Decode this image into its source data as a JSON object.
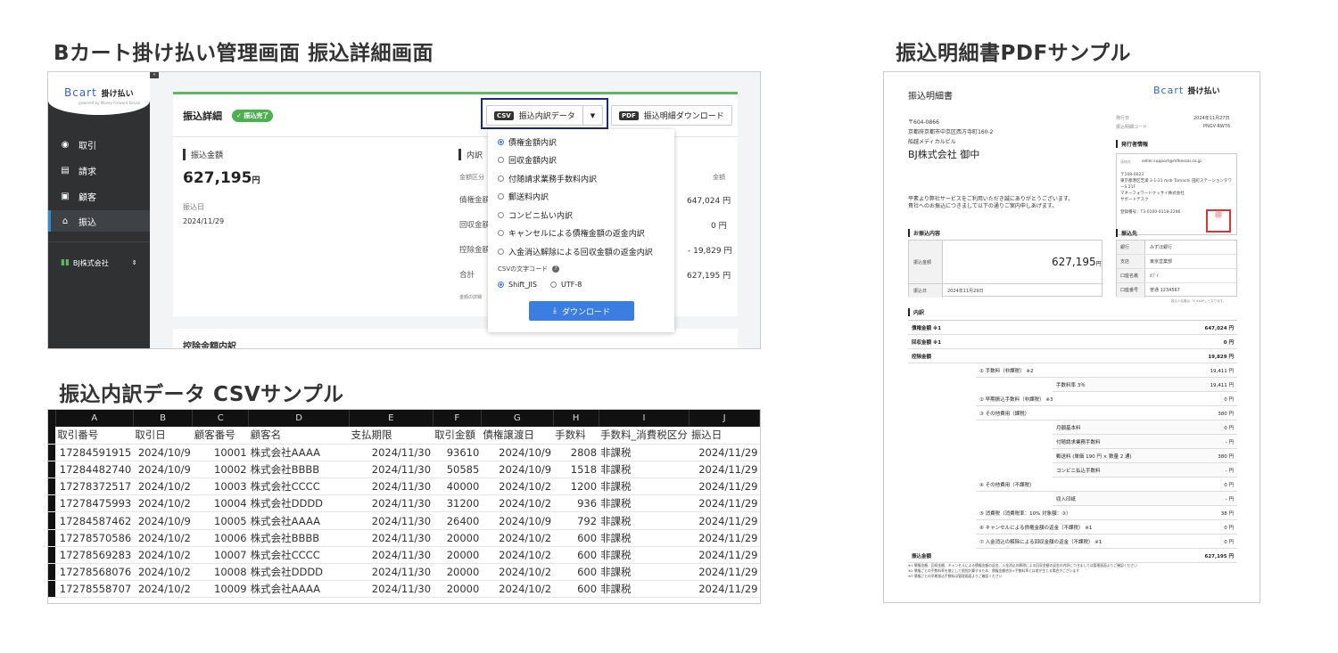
{
  "titles": {
    "admin": "Bカート掛け払い管理画面 振込詳細画面",
    "csv": "振込内訳データ CSVサンプル",
    "pdf": "振込明細書PDFサンプル"
  },
  "admin": {
    "logo": {
      "brand": "Bcart",
      "suffix": "掛け払い",
      "sub": "powered by Money Forward Kessai"
    },
    "nav": [
      {
        "label": "取引",
        "icon": "eye-icon"
      },
      {
        "label": "請求",
        "icon": "document-icon"
      },
      {
        "label": "顧客",
        "icon": "user-card-icon"
      },
      {
        "label": "振込",
        "icon": "bank-icon"
      }
    ],
    "company": "BJ株式会社",
    "header": {
      "title": "振込詳細",
      "badge": "✓ 振込完了",
      "csv_tag": "CSV",
      "csv_label": "振込内訳データ",
      "pdf_tag": "PDF",
      "pdf_label": "振込明細ダウンロード"
    },
    "amount": {
      "label": "振込金額",
      "value": "627,195",
      "unit": "円",
      "date_label": "振込日",
      "date": "2024/11/29"
    },
    "breakdown": {
      "label": "内訳",
      "col1": "金額区分",
      "col2": "金額",
      "rows": [
        {
          "label": "債権金額",
          "value": "647,024 円"
        },
        {
          "label": "回収金額",
          "value": "0 円"
        },
        {
          "label": "控除金額",
          "value": "- 19,829 円"
        },
        {
          "label": "合計",
          "value": "627,195 円"
        }
      ],
      "note": "金額の詳細"
    },
    "dropdown": {
      "options": [
        "債権金額内訳",
        "回収金額内訳",
        "付随請求業務手数料内訳",
        "郵送料内訳",
        "コンビニ払い内訳",
        "キャンセルによる債権金額の返金内訳",
        "入金消込解除による回収金額の返金内訳"
      ],
      "encoding_label": "CSVの文字コード",
      "enc1": "Shift_JIS",
      "enc2": "UTF-8",
      "download": "ダウンロード"
    },
    "next_section": "控除金額内訳"
  },
  "sheet": {
    "cols": [
      "A",
      "B",
      "C",
      "D",
      "E",
      "F",
      "G",
      "H",
      "I",
      "J"
    ],
    "headers": [
      "取引番号",
      "取引日",
      "顧客番号",
      "顧客名",
      "支払期限",
      "取引金額",
      "債権譲渡日",
      "手数料",
      "手数料_消費税区分",
      "振込日"
    ],
    "rows": [
      [
        "17284591915",
        "2024/10/9",
        "10001",
        "株式会社AAAA",
        "2024/11/30",
        "93610",
        "2024/10/9",
        "2808",
        "非課税",
        "2024/11/29"
      ],
      [
        "17284482740",
        "2024/10/9",
        "10002",
        "株式会社BBBB",
        "2024/11/30",
        "50585",
        "2024/10/9",
        "1518",
        "非課税",
        "2024/11/29"
      ],
      [
        "17278372517",
        "2024/10/2",
        "10003",
        "株式会社CCCC",
        "2024/11/30",
        "40000",
        "2024/10/2",
        "1200",
        "非課税",
        "2024/11/29"
      ],
      [
        "17278475993",
        "2024/10/2",
        "10004",
        "株式会社DDDD",
        "2024/11/30",
        "31200",
        "2024/10/2",
        "936",
        "非課税",
        "2024/11/29"
      ],
      [
        "17284587462",
        "2024/10/9",
        "10005",
        "株式会社AAAA",
        "2024/11/30",
        "26400",
        "2024/10/9",
        "792",
        "非課税",
        "2024/11/29"
      ],
      [
        "17278570586",
        "2024/10/2",
        "10006",
        "株式会社BBBB",
        "2024/11/30",
        "20000",
        "2024/10/2",
        "600",
        "非課税",
        "2024/11/29"
      ],
      [
        "17278569283",
        "2024/10/2",
        "10007",
        "株式会社CCCC",
        "2024/11/30",
        "20000",
        "2024/10/2",
        "600",
        "非課税",
        "2024/11/29"
      ],
      [
        "17278568076",
        "2024/10/2",
        "10008",
        "株式会社DDDD",
        "2024/11/30",
        "20000",
        "2024/10/2",
        "600",
        "非課税",
        "2024/11/29"
      ],
      [
        "17278558707",
        "2024/10/2",
        "10009",
        "株式会社AAAA",
        "2024/11/30",
        "20000",
        "2024/10/2",
        "600",
        "非課税",
        "2024/11/29"
      ]
    ]
  },
  "pdf": {
    "title": "振込明細書",
    "logo": "Bcart",
    "logo_suffix": "掛け払い",
    "postal": "〒604-0866",
    "addr": "京都府京都市中京区西方寺町160-2",
    "bldg": "船越メディカルビル",
    "recipient": "BJ株式会社 御中",
    "greeting1": "平素より弊社サービスをご利用いただき誠にありがとうございます。",
    "greeting2": "貴社へのお振込につきまして以下の通りご案内申しあげます。",
    "issue_label": "発行日",
    "issue_date": "2024年11月27日",
    "code_label": "振込明細コード",
    "code": "PNGV-RW76",
    "issuer_label": "発行者情報",
    "contact_label": "連絡先",
    "email": "seller.support@mfkessai.co.jp",
    "issuer_lines": [
      "〒108-0023",
      "東京都港区芝浦 3-1-21 msb Tamachi 田町ステーションタワーS 21F",
      "マネーフォワードケッサイ株式会社",
      "サポートデスク"
    ],
    "reg": "登録番号：T3-0100-0118-2296",
    "transfer_label": "お振込内容",
    "amount_label": "振込金額",
    "amount": "627,195",
    "unit": "円",
    "date_label": "振込日",
    "date": "2024年11月29日",
    "dest_label": "振込先",
    "dest": [
      [
        "銀行",
        "みずほ銀行"
      ],
      [
        "支店",
        "東京営業部"
      ],
      [
        "口座名義",
        "ｶﾌﾞｲ"
      ],
      [
        "口座番号",
        "普通 1234567"
      ]
    ],
    "dest_note": "振込人名義は「X XXXP」となります。",
    "items_label": "内訳",
    "items": [
      {
        "label": "債権金額 ※1",
        "value": "647,024 円",
        "bold": true
      },
      {
        "label": "回収金額 ※1",
        "value": "0 円",
        "bold": true
      },
      {
        "label": "控除金額",
        "value": "19,829 円",
        "bold": true
      },
      {
        "label": "① 手数料（非課税） ※2",
        "value": "19,411 円",
        "indent": 1
      },
      {
        "label": "手数料率 3％",
        "value": "19,411 円",
        "indent": 2
      },
      {
        "label": "② 早期振込手数料（非課税） ※3",
        "value": "0 円",
        "indent": 1
      },
      {
        "label": "③ その他費用（課税）",
        "value": "380 円",
        "indent": 1
      },
      {
        "label": "月額基本料",
        "value": "0 円",
        "indent": 2
      },
      {
        "label": "付随請求業務手数料",
        "value": "- 円",
        "indent": 2
      },
      {
        "label": "郵送料 (単価 190 円 × 数量 2 通)",
        "value": "380 円",
        "indent": 2
      },
      {
        "label": "コンビニ払込手数料",
        "value": "- 円",
        "indent": 2
      },
      {
        "label": "④ その他費用（不課税）",
        "value": "0 円",
        "indent": 1
      },
      {
        "label": "収入印紙",
        "value": "- 円",
        "indent": 2
      },
      {
        "label": "⑤ 消費税（消費税率：10% 対象額：③）",
        "value": "38 円",
        "indent": 1
      },
      {
        "label": "⑥ キャンセルによる債権金額の返金（不課税） ※1",
        "value": "0 円",
        "indent": 1
      },
      {
        "label": "⑦ 入金消込の解除による回収金額の返金（不課税） ※1",
        "value": "0 円",
        "indent": 1
      },
      {
        "label": "振込金額",
        "value": "627,195 円",
        "bold": true
      }
    ],
    "notes": [
      "※1 債権金額、回収金額、キャンセルによる債権金額の返金、入金消込の解除による回収金額の返金の内訳につきましては管理画面よりご確認ください",
      "※2 債権ごとの手数料率を基にして個別計算するため、債権金額合計×手数料率とは差が生じる場合がございます",
      "※3 債権ごとの早期振込手数料は管理画面よりご確認ください"
    ]
  }
}
